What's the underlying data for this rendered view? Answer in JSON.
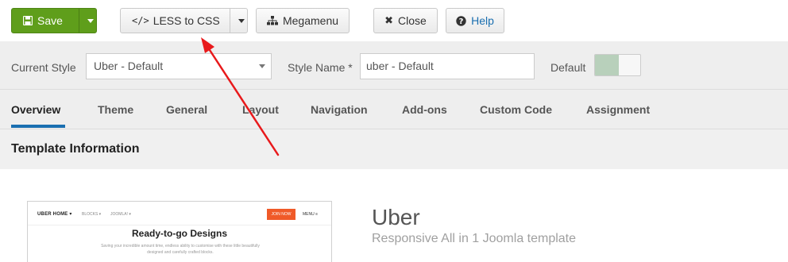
{
  "toolbar": {
    "save_label": "Save",
    "less_label": "LESS to CSS",
    "megamenu_label": "Megamenu",
    "close_label": "Close",
    "help_label": "Help",
    "save_icon": "floppy-icon",
    "less_icon": "code-icon",
    "megamenu_icon": "sitemap-icon",
    "close_icon": "close-icon",
    "help_icon": "question-circle-icon",
    "save_color": "#5f9e1b",
    "help_color": "#1a6fb0"
  },
  "style_bar": {
    "current_style_label": "Current Style",
    "current_style_value": "Uber - Default",
    "style_name_label": "Style Name *",
    "style_name_value": "uber - Default",
    "default_label": "Default",
    "default_on": true
  },
  "tabs": [
    {
      "label": "Overview",
      "active": true
    },
    {
      "label": "Theme"
    },
    {
      "label": "General"
    },
    {
      "label": "Layout"
    },
    {
      "label": "Navigation"
    },
    {
      "label": "Add-ons"
    },
    {
      "label": "Custom Code"
    },
    {
      "label": "Assignment"
    }
  ],
  "section": {
    "title": "Template Information"
  },
  "template": {
    "name": "Uber",
    "description": "Responsive All in 1 Joomla template",
    "preview": {
      "brand": "UBER HOME ▾",
      "link_blocks": "BLOCKS ▾",
      "link_joomla": "JOOMLA! ▾",
      "join": "JOIN NOW",
      "menu": "MENU ≡",
      "heading": "Ready-to-go Designs",
      "subtext": "Saving your incredible amount time, endless ability to customise with these little beautifully designed and carefully crafted blocks."
    }
  },
  "annotation": {
    "arrow_color": "#e8191b"
  }
}
